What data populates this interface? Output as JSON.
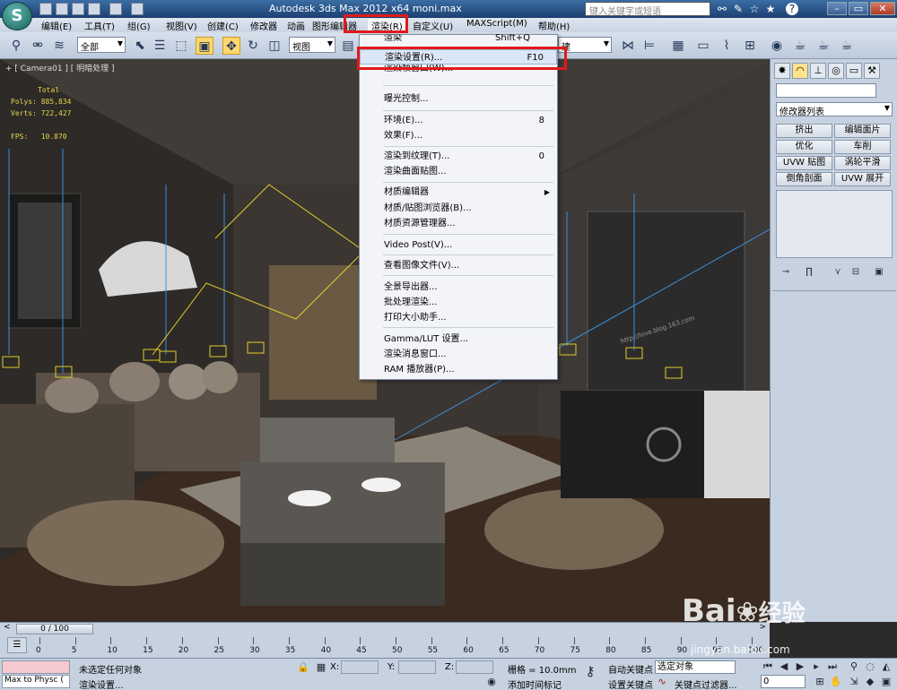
{
  "titlebar": {
    "app_letter": "S",
    "title": "Autodesk 3ds Max  2012 x64      moni.max",
    "search_placeholder": "键入关键字或短语"
  },
  "menubar": {
    "items": [
      "编辑(E)",
      "工具(T)",
      "组(G)",
      "视图(V)",
      "创建(C)",
      "修改器",
      "动画",
      "图形编辑器",
      "渲染(R)",
      "自定义(U)",
      "MAXScript(M)",
      "帮助(H)"
    ],
    "highlighted": "渲染(R)"
  },
  "toolbar": {
    "selection_filter": "全部",
    "reference_coord": "视图",
    "right_dropdown": "建"
  },
  "viewport": {
    "label": "+ [ Camera01 ] [ 明暗处理 ]",
    "stats": {
      "header": "Total",
      "polys_label": "Polys:",
      "polys_value": "885,834",
      "verts_label": "Verts:",
      "verts_value": "722,427",
      "fps_label": "FPS:",
      "fps_value": "10.870"
    },
    "url_watermark": "http://love.blog.163.com"
  },
  "render_menu": {
    "partial_top": "渲染",
    "partial_top_shortcut": "Shift+Q",
    "items": [
      {
        "label": "渲染设置(R)...",
        "shortcut": "F10",
        "highlighted": true
      },
      {
        "label": "渲染帧窗口(W)...",
        "shortcut": ""
      },
      {
        "label": "曝光控制...",
        "shortcut": ""
      },
      {
        "label": "环境(E)...",
        "shortcut": "8"
      },
      {
        "label": "效果(F)...",
        "shortcut": ""
      },
      {
        "label": "渲染到纹理(T)...",
        "shortcut": "0"
      },
      {
        "label": "渲染曲面贴图...",
        "shortcut": ""
      },
      {
        "label": "材质编辑器",
        "shortcut": "",
        "submenu": true
      },
      {
        "label": "材质/贴图浏览器(B)...",
        "shortcut": ""
      },
      {
        "label": "材质资源管理器...",
        "shortcut": ""
      },
      {
        "label": "Video Post(V)...",
        "shortcut": ""
      },
      {
        "label": "查看图像文件(V)...",
        "shortcut": ""
      },
      {
        "label": "全景导出器...",
        "shortcut": ""
      },
      {
        "label": "批处理渲染...",
        "shortcut": ""
      },
      {
        "label": "打印大小助手...",
        "shortcut": ""
      },
      {
        "label": "Gamma/LUT 设置...",
        "shortcut": ""
      },
      {
        "label": "渲染消息窗口...",
        "shortcut": ""
      },
      {
        "label": "RAM 播放器(P)...",
        "shortcut": ""
      }
    ]
  },
  "command_panel": {
    "modifier_list": "修改器列表",
    "buttons": [
      "挤出",
      "编辑面片",
      "优化",
      "车削",
      "UVW 贴图",
      "涡轮平滑",
      "倒角剖面",
      "UVW 展开"
    ]
  },
  "timeline": {
    "position": "0 / 100",
    "ticks": [
      "0",
      "5",
      "10",
      "15",
      "20",
      "25",
      "30",
      "35",
      "40",
      "45",
      "50",
      "55",
      "60",
      "65",
      "70",
      "75",
      "80",
      "85",
      "90",
      "95",
      "100"
    ]
  },
  "statusbar": {
    "listener_line": "Max to Physc (",
    "status_top": "未选定任何对象",
    "status_bottom": "渲染设置...",
    "x_label": "X:",
    "y_label": "Y:",
    "z_label": "Z:",
    "grid": "栅格 = 10.0mm",
    "add_time_tag": "添加时间标记",
    "auto_key": "自动关键点",
    "selected_obj": "选定对象",
    "set_key": "设置关键点",
    "key_filters": "关键点过滤器...",
    "frame_value": "0"
  },
  "watermark": {
    "brand": "Bai",
    "brand2": "经验",
    "url": "jingyan.baidu.com"
  }
}
